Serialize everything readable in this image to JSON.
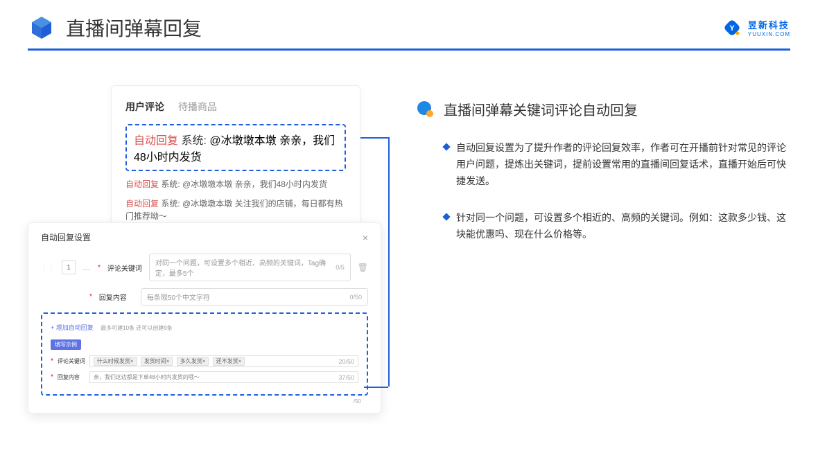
{
  "header": {
    "title": "直播间弹幕回复",
    "logo_cn": "昱新科技",
    "logo_en": "YUUXIN.COM"
  },
  "comment_card": {
    "tab_active": "用户评论",
    "tab_inactive": "待播商品",
    "highlighted": {
      "prefix": "自动回复",
      "system": "系统:",
      "text": "@冰墩墩本墩 亲亲，我们48小时内发货"
    },
    "line2": {
      "prefix": "自动回复",
      "system": "系统:",
      "text": "@冰墩墩本墩 亲亲，我们48小时内发货"
    },
    "line3": {
      "prefix": "自动回复",
      "system": "系统:",
      "text": "@冰墩墩本墩 关注我们的店铺，每日都有热门推荐呦～"
    }
  },
  "settings": {
    "title": "自动回复设置",
    "index": "1",
    "keyword_label": "评论关键词",
    "keyword_placeholder": "对同一个问题，可设置多个相近、高频的关键词，Tag确定，最多5个",
    "keyword_count": "0/5",
    "content_label": "回复内容",
    "content_placeholder": "每条限50个中文字符",
    "content_count": "0/50",
    "add_link": "+ 增加自动回复",
    "quota": "最多可建10条 还可以创建9条",
    "example_badge": "填写示例",
    "ex_keyword_label": "评论关键词",
    "ex_tags": [
      "什么时候发货×",
      "发货时间×",
      "多久发货×",
      "还不发货×"
    ],
    "ex_keyword_count": "20/50",
    "ex_content_label": "回复内容",
    "ex_content_text": "亲，我们这边都是下单48小时内发货的哦～",
    "ex_content_count": "37/50",
    "bottom_count": "/50"
  },
  "right": {
    "section_title": "直播间弹幕关键词评论自动回复",
    "bullet1": "自动回复设置为了提升作者的评论回复效率，作者可在开播前针对常见的评论用户问题，提炼出关键词，提前设置常用的直播间回复话术，直播开始后可快捷发送。",
    "bullet2": "针对同一个问题，可设置多个相近的、高频的关键词。例如：这款多少钱、这块能优惠吗、现在什么价格等。"
  }
}
